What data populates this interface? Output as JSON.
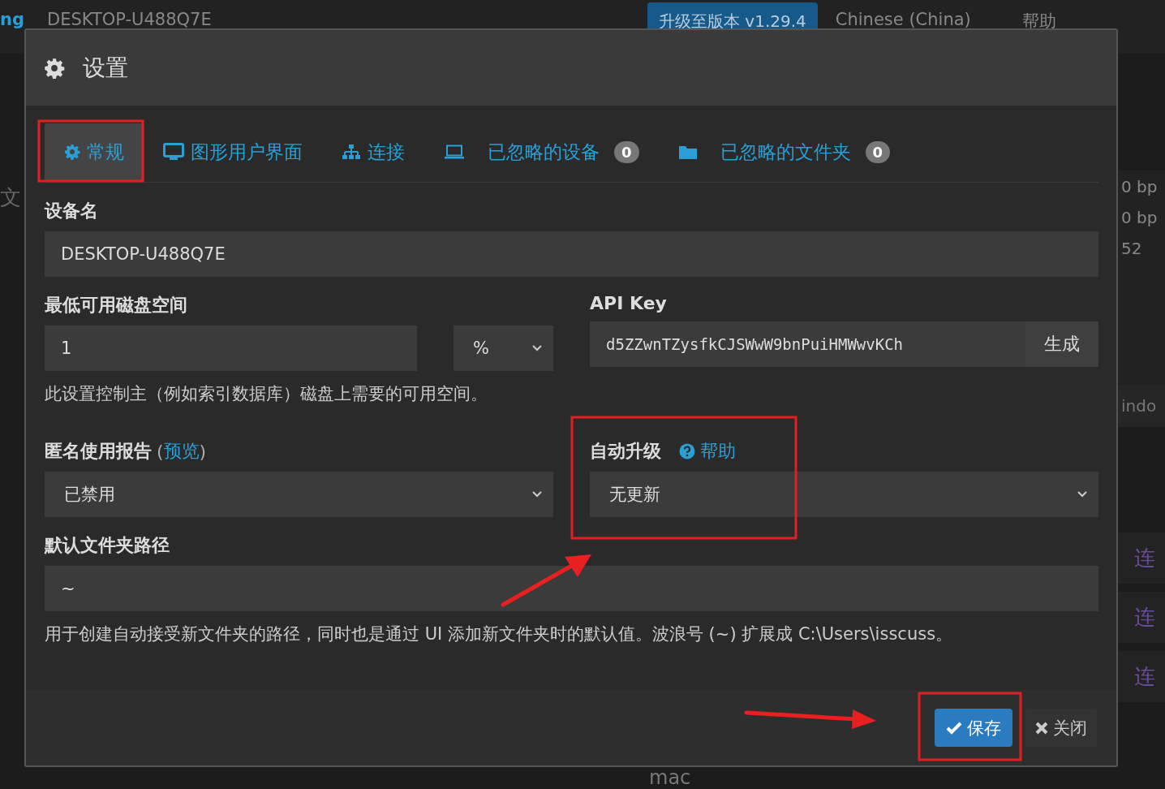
{
  "background": {
    "brand": "ng",
    "device": "DESKTOP-U488Q7E",
    "upgrade_button": "升级至版本 v1.29.4",
    "language": "Chinese (China)",
    "help": "帮助",
    "left_text": "文",
    "right_texts": [
      "0 bp",
      "0 bp",
      "52",
      "indo"
    ],
    "connect_links": [
      "连",
      "连",
      "连"
    ],
    "bottom_text": "mac"
  },
  "dialog": {
    "title": "设置",
    "tabs": [
      {
        "label": "常规",
        "selected": true
      },
      {
        "label": "图形用户界面",
        "selected": false
      },
      {
        "label": "连接",
        "selected": false
      },
      {
        "label": "已忽略的设备",
        "selected": false,
        "badge": "0"
      },
      {
        "label": "已忽略的文件夹",
        "selected": false,
        "badge": "0"
      }
    ],
    "device_name": {
      "label": "设备名",
      "value": "DESKTOP-U488Q7E"
    },
    "min_disk": {
      "label": "最低可用磁盘空间",
      "value": "1",
      "unit": "%",
      "help": "此设置控制主（例如索引数据库）磁盘上需要的可用空间。"
    },
    "api_key": {
      "label": "API Key",
      "value": "d5ZZwnTZysfkCJSWwW9bnPuiHMWwvKCh",
      "button": "生成"
    },
    "usage_reporting": {
      "label": "匿名使用报告",
      "open": "(",
      "link": "预览",
      "close": ")",
      "value": "已禁用"
    },
    "auto_upgrade": {
      "label": "自动升级",
      "help_link": "帮助",
      "value": "无更新"
    },
    "default_folder": {
      "label": "默认文件夹路径",
      "value": "~",
      "help": "用于创建自动接受新文件夹的路径，同时也是通过 UI 添加新文件夹时的默认值。波浪号 (~) 扩展成 C:\\Users\\isscuss。"
    },
    "buttons": {
      "save": "保存",
      "close": "关闭"
    }
  }
}
